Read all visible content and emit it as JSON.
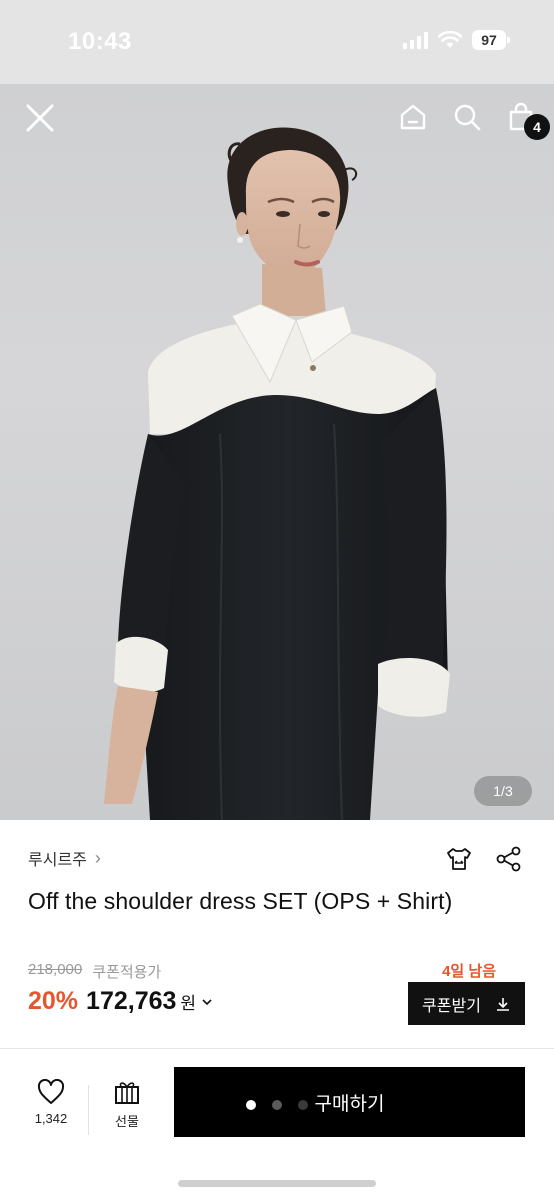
{
  "status_bar": {
    "time": "10:43",
    "battery": "97"
  },
  "hero": {
    "page_indicator": "1/3",
    "cart_count": "4"
  },
  "product": {
    "brand": "루시르주",
    "brand_chevron": "›",
    "title": "Off the shoulder dress SET (OPS + Shirt)",
    "original_price": "218,000",
    "coupon_label": "쿠폰적용가",
    "discount": "20%",
    "price": "172,763",
    "currency": "원",
    "days_left": "4일 남음",
    "coupon_button": "쿠폰받기"
  },
  "bottom_bar": {
    "like_count": "1,342",
    "gift_label": "선물",
    "buy_label": "구매하기"
  },
  "colors": {
    "accent": "#e4572e",
    "button": "#000000",
    "badge": "#111111"
  },
  "icons": [
    "close-icon",
    "home-icon",
    "search-icon",
    "bag-icon",
    "shirt-size-icon",
    "share-icon",
    "download-icon",
    "heart-icon",
    "gift-icon",
    "chevron-down-icon"
  ]
}
